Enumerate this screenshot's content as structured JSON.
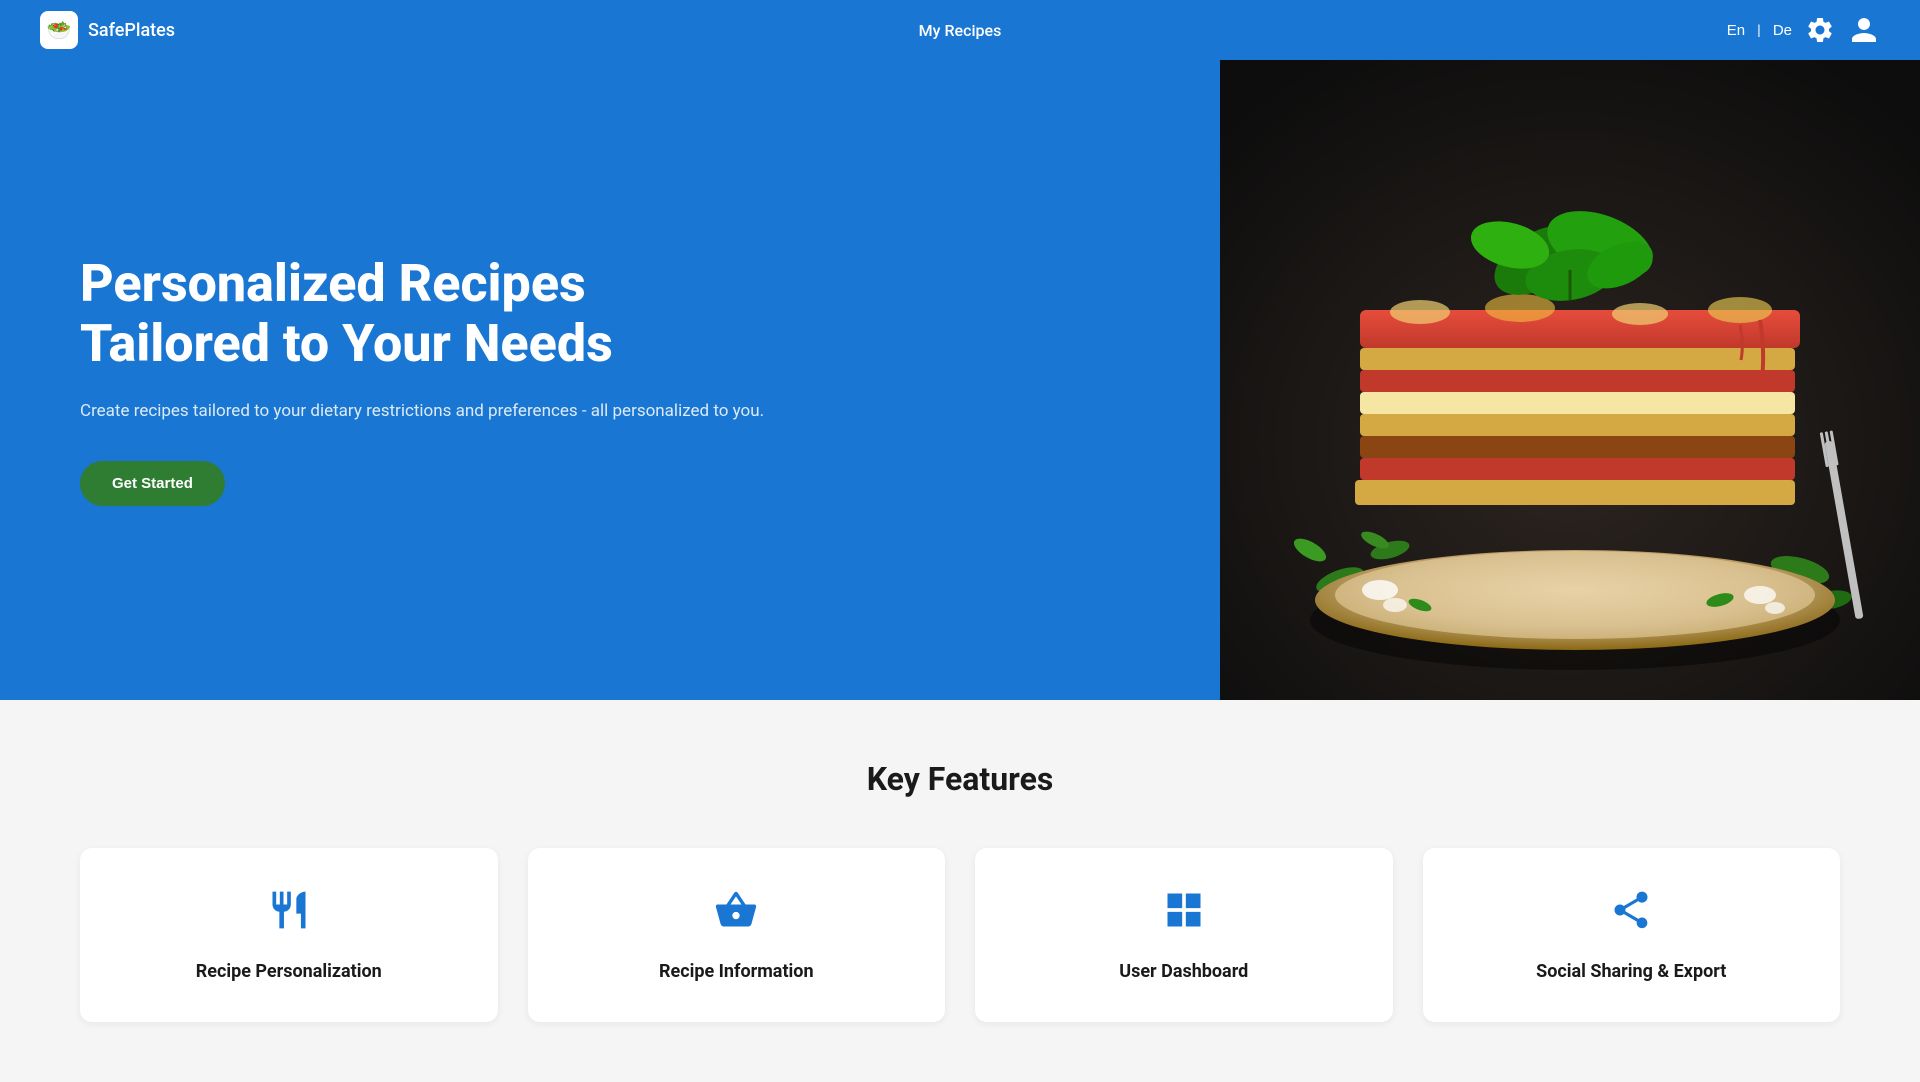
{
  "navbar": {
    "brand_logo_emoji": "🥗",
    "brand_name": "SafePlates",
    "nav_center_label": "My Recipes",
    "lang_en": "En",
    "lang_separator": "|",
    "lang_de": "De"
  },
  "hero": {
    "title": "Personalized Recipes Tailored to Your Needs",
    "subtitle": "Create recipes tailored to your dietary restrictions and preferences - all personalized to you.",
    "cta_label": "Get Started"
  },
  "features": {
    "section_title": "Key Features",
    "cards": [
      {
        "name": "Recipe Personalization",
        "icon_type": "utensils"
      },
      {
        "name": "Recipe Information",
        "icon_type": "basket"
      },
      {
        "name": "User Dashboard",
        "icon_type": "dashboard"
      },
      {
        "name": "Social Sharing & Export",
        "icon_type": "share"
      }
    ]
  }
}
